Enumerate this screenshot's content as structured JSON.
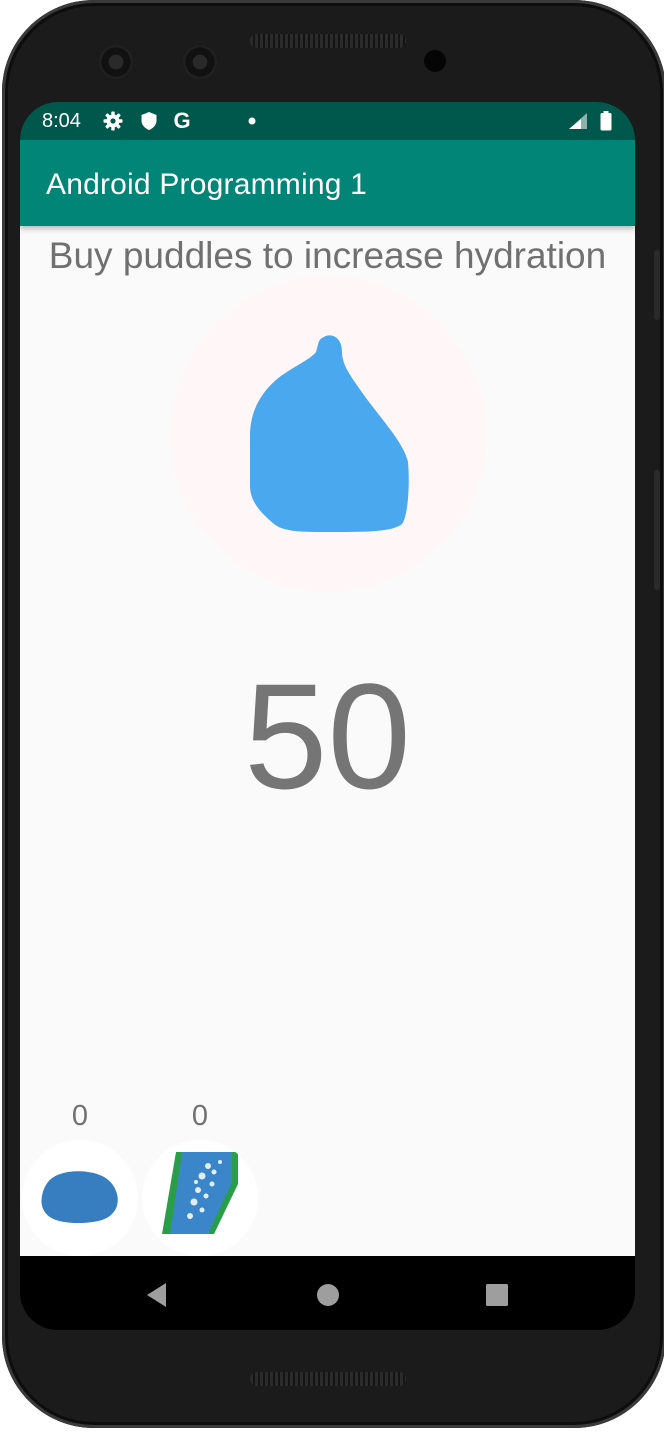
{
  "status_bar": {
    "time": "8:04",
    "icons": [
      "gear-icon",
      "shield-icon",
      "google-icon",
      "notification-dot-icon",
      "cell-signal-icon",
      "battery-icon"
    ],
    "google_letter": "G",
    "color": "#00574b"
  },
  "app_bar": {
    "title": "Android Programming 1",
    "color": "#008577"
  },
  "main": {
    "instruction": "Buy puddles to increase hydration",
    "counter": "50",
    "drop_icon": "water-drop-icon",
    "drop_color": "#4aa8ee"
  },
  "shop": {
    "items": [
      {
        "count": "0",
        "icon": "puddle-icon",
        "color": "#367ec0"
      },
      {
        "count": "0",
        "icon": "river-icon",
        "color": "#2e99d2"
      }
    ]
  },
  "nav_bar": {
    "buttons": [
      "back-icon",
      "home-icon",
      "recents-icon"
    ]
  }
}
